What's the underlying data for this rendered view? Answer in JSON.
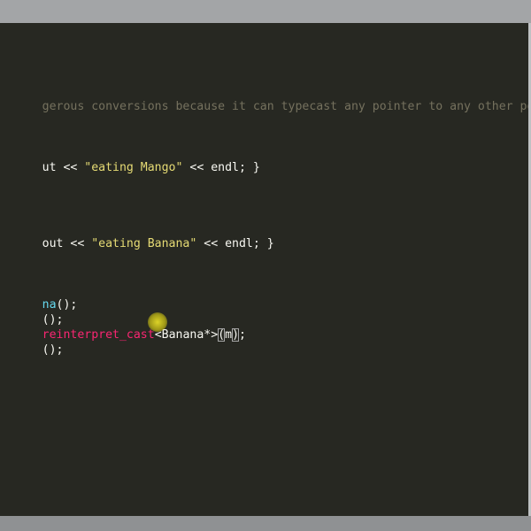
{
  "editor": {
    "lines": {
      "comment": "gerous conversions because it can typecast any pointer to any other pointer.",
      "mango_pre": "ut << ",
      "mango_str": "\"eating Mango\"",
      "mango_post": " << endl; }",
      "banana_pre": "out << ",
      "banana_str": "\"eating Banana\"",
      "banana_post": " << endl; }",
      "new_fn": "na",
      "new_post": "();",
      "call1": "();",
      "cast_kw": "reinterpret_cast",
      "cast_type_pre": "<Banana",
      "cast_star": "*",
      "cast_type_close": ">",
      "cast_paren_open": "(",
      "cast_arg": "m",
      "cast_paren_close": ")",
      "cast_end": ";",
      "call2": "();"
    }
  },
  "colors": {
    "background": "#272822",
    "text": "#f8f8f2",
    "comment": "#75715e",
    "string": "#e6db74",
    "function": "#66d9ef",
    "keyword": "#f92672"
  }
}
